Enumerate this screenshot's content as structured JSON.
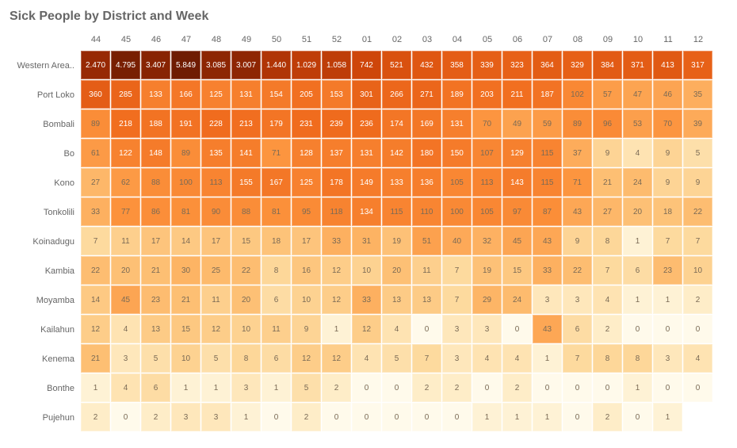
{
  "title": "Sick People by District and Week",
  "chart_data": {
    "type": "heatmap",
    "xlabel": "",
    "ylabel": "",
    "x_categories": [
      "44",
      "45",
      "46",
      "47",
      "48",
      "49",
      "50",
      "51",
      "52",
      "01",
      "02",
      "03",
      "04",
      "05",
      "06",
      "07",
      "08",
      "09",
      "10",
      "11",
      "12"
    ],
    "y_categories": [
      "Western Area..",
      "Port Loko",
      "Bombali",
      "Bo",
      "Kono",
      "Tonkolili",
      "Koinadugu",
      "Kambia",
      "Moyamba",
      "Kailahun",
      "Kenema",
      "Bonthe",
      "Pujehun"
    ],
    "values": [
      [
        2470,
        4795,
        3407,
        5849,
        3085,
        3007,
        1440,
        1029,
        1058,
        742,
        521,
        432,
        358,
        339,
        323,
        364,
        329,
        384,
        371,
        413,
        317
      ],
      [
        360,
        285,
        133,
        166,
        125,
        131,
        154,
        205,
        153,
        301,
        266,
        271,
        189,
        203,
        211,
        187,
        102,
        57,
        47,
        46,
        35
      ],
      [
        89,
        218,
        188,
        191,
        228,
        213,
        179,
        231,
        239,
        236,
        174,
        169,
        131,
        70,
        49,
        59,
        89,
        96,
        53,
        70,
        39
      ],
      [
        61,
        122,
        148,
        89,
        135,
        141,
        71,
        128,
        137,
        131,
        142,
        180,
        150,
        107,
        129,
        115,
        37,
        9,
        4,
        9,
        5
      ],
      [
        27,
        62,
        88,
        100,
        113,
        155,
        167,
        125,
        178,
        149,
        133,
        136,
        105,
        113,
        143,
        115,
        71,
        21,
        24,
        9,
        9
      ],
      [
        33,
        77,
        86,
        81,
        90,
        88,
        81,
        95,
        118,
        134,
        115,
        110,
        100,
        105,
        97,
        87,
        43,
        27,
        20,
        18,
        22
      ],
      [
        7,
        11,
        17,
        14,
        17,
        15,
        18,
        17,
        33,
        31,
        19,
        51,
        40,
        32,
        45,
        43,
        9,
        8,
        1,
        7,
        7
      ],
      [
        22,
        20,
        21,
        30,
        25,
        22,
        8,
        16,
        12,
        10,
        20,
        11,
        7,
        19,
        15,
        33,
        22,
        7,
        6,
        23,
        10
      ],
      [
        14,
        45,
        23,
        21,
        11,
        20,
        6,
        10,
        12,
        33,
        13,
        13,
        7,
        29,
        24,
        3,
        3,
        4,
        1,
        1,
        2
      ],
      [
        12,
        4,
        13,
        15,
        12,
        10,
        11,
        9,
        1,
        12,
        4,
        0,
        3,
        3,
        0,
        43,
        6,
        2,
        0,
        0,
        0
      ],
      [
        21,
        3,
        5,
        10,
        5,
        8,
        6,
        12,
        12,
        4,
        5,
        7,
        3,
        4,
        4,
        1,
        7,
        8,
        8,
        3,
        4
      ],
      [
        1,
        4,
        6,
        1,
        1,
        3,
        1,
        5,
        2,
        0,
        0,
        2,
        2,
        0,
        2,
        0,
        0,
        0,
        1,
        0,
        0
      ],
      [
        2,
        0,
        2,
        3,
        3,
        1,
        0,
        2,
        0,
        0,
        0,
        0,
        0,
        1,
        1,
        1,
        0,
        2,
        0,
        1
      ]
    ],
    "display_values": [
      [
        "2.470",
        "4.795",
        "3.407",
        "5.849",
        "3.085",
        "3.007",
        "1.440",
        "1.029",
        "1.058",
        "742",
        "521",
        "432",
        "358",
        "339",
        "323",
        "364",
        "329",
        "384",
        "371",
        "413",
        "317"
      ],
      [
        "360",
        "285",
        "133",
        "166",
        "125",
        "131",
        "154",
        "205",
        "153",
        "301",
        "266",
        "271",
        "189",
        "203",
        "211",
        "187",
        "102",
        "57",
        "47",
        "46",
        "35"
      ],
      [
        "89",
        "218",
        "188",
        "191",
        "228",
        "213",
        "179",
        "231",
        "239",
        "236",
        "174",
        "169",
        "131",
        "70",
        "49",
        "59",
        "89",
        "96",
        "53",
        "70",
        "39"
      ],
      [
        "61",
        "122",
        "148",
        "89",
        "135",
        "141",
        "71",
        "128",
        "137",
        "131",
        "142",
        "180",
        "150",
        "107",
        "129",
        "115",
        "37",
        "9",
        "4",
        "9",
        "5"
      ],
      [
        "27",
        "62",
        "88",
        "100",
        "113",
        "155",
        "167",
        "125",
        "178",
        "149",
        "133",
        "136",
        "105",
        "113",
        "143",
        "115",
        "71",
        "21",
        "24",
        "9",
        "9"
      ],
      [
        "33",
        "77",
        "86",
        "81",
        "90",
        "88",
        "81",
        "95",
        "118",
        "134",
        "115",
        "110",
        "100",
        "105",
        "97",
        "87",
        "43",
        "27",
        "20",
        "18",
        "22"
      ],
      [
        "7",
        "11",
        "17",
        "14",
        "17",
        "15",
        "18",
        "17",
        "33",
        "31",
        "19",
        "51",
        "40",
        "32",
        "45",
        "43",
        "9",
        "8",
        "1",
        "7",
        "7"
      ],
      [
        "22",
        "20",
        "21",
        "30",
        "25",
        "22",
        "8",
        "16",
        "12",
        "10",
        "20",
        "11",
        "7",
        "19",
        "15",
        "33",
        "22",
        "7",
        "6",
        "23",
        "10"
      ],
      [
        "14",
        "45",
        "23",
        "21",
        "11",
        "20",
        "6",
        "10",
        "12",
        "33",
        "13",
        "13",
        "7",
        "29",
        "24",
        "3",
        "3",
        "4",
        "1",
        "1",
        "2"
      ],
      [
        "12",
        "4",
        "13",
        "15",
        "12",
        "10",
        "11",
        "9",
        "1",
        "12",
        "4",
        "0",
        "3",
        "3",
        "0",
        "43",
        "6",
        "2",
        "0",
        "0",
        "0"
      ],
      [
        "21",
        "3",
        "5",
        "10",
        "5",
        "8",
        "6",
        "12",
        "12",
        "4",
        "5",
        "7",
        "3",
        "4",
        "4",
        "1",
        "7",
        "8",
        "8",
        "3",
        "4"
      ],
      [
        "1",
        "4",
        "6",
        "1",
        "1",
        "3",
        "1",
        "5",
        "2",
        "0",
        "0",
        "2",
        "2",
        "0",
        "2",
        "0",
        "0",
        "0",
        "1",
        "0",
        "0"
      ],
      [
        "2",
        "0",
        "2",
        "3",
        "3",
        "1",
        "0",
        "2",
        "0",
        "0",
        "0",
        "0",
        "0",
        "1",
        "1",
        "1",
        "0",
        "2",
        "0",
        "1"
      ]
    ]
  }
}
